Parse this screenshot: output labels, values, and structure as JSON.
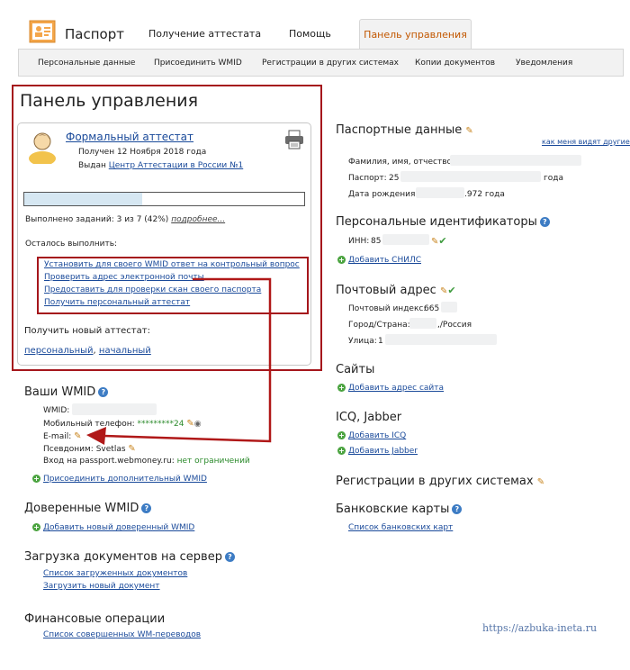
{
  "header": {
    "brand": "Паспорт",
    "tabs": [
      {
        "label": "Получение аттестата"
      },
      {
        "label": "Помощь"
      },
      {
        "label": "Панель управления"
      }
    ],
    "subnav": [
      "Персональные данные",
      "Присоединить WMID",
      "Регистрации в других системах",
      "Копии документов",
      "Уведомления"
    ]
  },
  "panel": {
    "title": "Панель управления",
    "attestat_title": "Формальный аттестат",
    "received": "Получен 12 Ноября 2018 года",
    "issued_prefix": "Выдан ",
    "issued_link": "Центр Аттестации в России №1",
    "progress_fraction": 0.42,
    "tasks_done": "Выполнено заданий: 3 из 7 (42%)",
    "more_link": "подробнее...",
    "remaining_label": "Осталось выполнить:",
    "remaining": [
      "Установить для своего WMID ответ на контрольный вопрос",
      "Проверить адрес электронной почты",
      "Предоставить для проверки скан своего паспорта",
      "Получить персональный аттестат"
    ],
    "new_attestat_label": "Получить новый аттестат:",
    "new_personal": "персональный",
    "new_sep": ", ",
    "new_initial": "начальный"
  },
  "wmid": {
    "title": "Ваши WMID",
    "wmid_label": "WMID:",
    "phone_label": "Мобильный телефон:",
    "phone_value": "*********24",
    "email_label": "E-mail:",
    "nick_label": "Псевдоним:",
    "nick_value": "Svetlas",
    "login_label": "Вход на passport.webmoney.ru:",
    "login_value": "нет ограничений",
    "add_link": "Присоединить дополнительный WMID"
  },
  "trusted": {
    "title": "Доверенные WMID",
    "add_link": "Добавить новый доверенный WMID"
  },
  "uploads": {
    "title": "Загрузка документов на сервер",
    "list_link": "Список загруженных документов",
    "upload_link": "Загрузить новый документ"
  },
  "finance": {
    "title": "Финансовые операции",
    "list_link": "Список совершенных WM-переводов"
  },
  "passport": {
    "title": "Паспортные данные",
    "how_link": "как меня видят другие?",
    "fio_label": "Фамилия, имя, отчество:",
    "passport_label": "Паспорт:",
    "passport_prefix": "25",
    "passport_suffix": "года",
    "birth_label": "Дата рождения:",
    "birth_value": ".972 года"
  },
  "ids": {
    "title": "Персональные идентификаторы",
    "inn_label": "ИНН:",
    "inn_value": "85",
    "add_snils": "Добавить СНИЛС"
  },
  "postal": {
    "title": "Почтовый адрес",
    "index_label": "Почтовый индекс:",
    "index_value": "665",
    "city_label": "Город/Страна:",
    "city_value": ",/Россия",
    "street_label": "Улица:",
    "street_value": "1"
  },
  "sites": {
    "title": "Сайты",
    "add_link": "Добавить адрес сайта"
  },
  "icq": {
    "title": "ICQ, Jabber",
    "add_icq": "Добавить ICQ",
    "add_jabber": "Добавить Jabber"
  },
  "regs": {
    "title": "Регистрации в других системах"
  },
  "cards": {
    "title": "Банковские карты",
    "list_link": "Список банковских карт"
  },
  "watermark": "https://azbuka-ineta.ru",
  "colors": {
    "accent": "#c25700",
    "frame_red": "#a5161c",
    "link": "#1a4a9a"
  }
}
